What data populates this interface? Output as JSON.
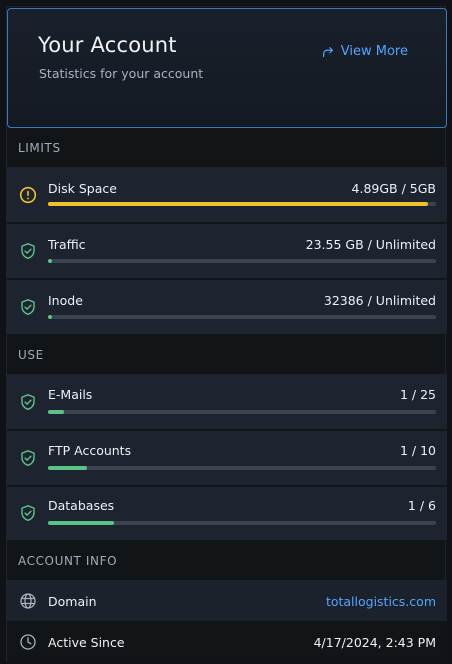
{
  "header": {
    "title": "Your Account",
    "subtitle": "Statistics for your account",
    "view_more": "View More"
  },
  "sections": {
    "limits": "LIMITS",
    "use": "USE",
    "account_info": "ACCOUNT INFO"
  },
  "limits": [
    {
      "label": "Disk Space",
      "value": "4.89GB / 5GB",
      "status": "warning",
      "progress": 0.98
    },
    {
      "label": "Traffic",
      "value": "23.55 GB / Unlimited",
      "status": "ok",
      "progress": 0.01
    },
    {
      "label": "Inode",
      "value": "32386 / Unlimited",
      "status": "ok",
      "progress": 0.01
    }
  ],
  "use": [
    {
      "label": "E-Mails",
      "value": "1 / 25",
      "status": "ok",
      "progress": 0.04
    },
    {
      "label": "FTP Accounts",
      "value": "1 / 10",
      "status": "ok",
      "progress": 0.1
    },
    {
      "label": "Databases",
      "value": "1 / 6",
      "status": "ok",
      "progress": 0.17
    }
  ],
  "account_info": [
    {
      "label": "Domain",
      "value": "totallogistics.com",
      "icon": "globe-icon"
    },
    {
      "label": "Active Since",
      "value": "4/17/2024, 2:43 PM",
      "icon": "clock-icon"
    }
  ],
  "colors": {
    "accent": "#56a3ff",
    "ok": "#5cc387",
    "warning": "#f0c12c",
    "bar_track": "#3a4350"
  }
}
